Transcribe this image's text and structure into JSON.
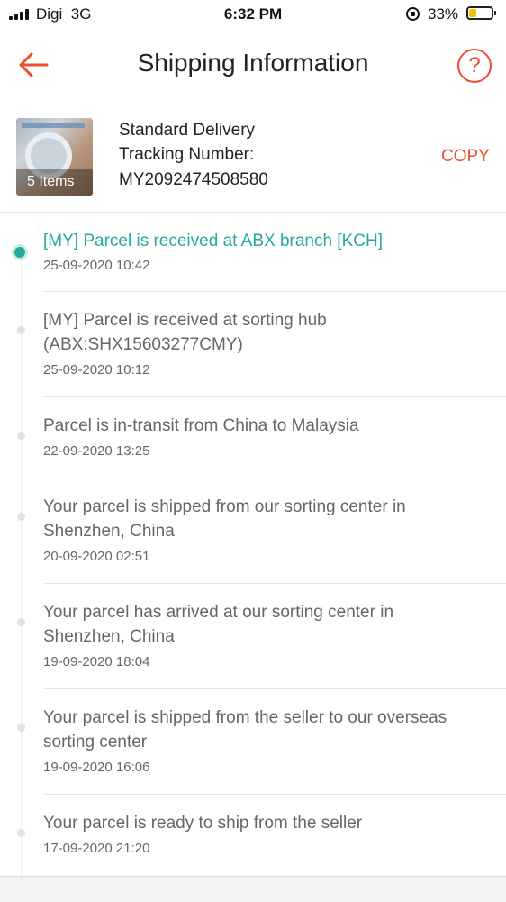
{
  "status_bar": {
    "carrier": "Digi",
    "network": "3G",
    "time": "6:32 PM",
    "battery_percent": "33%",
    "battery_level": 0.33,
    "icons": [
      "signal-icon",
      "orientation-lock-icon",
      "battery-icon"
    ]
  },
  "header": {
    "title": "Shipping Information",
    "back_icon": "back-arrow-icon",
    "help_icon": "?"
  },
  "delivery": {
    "items_label": "5 Items",
    "service": "Standard Delivery",
    "tracking_label": "Tracking Number:",
    "tracking_number": "MY2092474508580",
    "copy_label": "COPY"
  },
  "colors": {
    "accent": "#ee4d2d",
    "active_status": "#26aa99",
    "inactive_dot": "#e2e2e2"
  },
  "events": [
    {
      "text": "[MY] Parcel is received at ABX branch [KCH]",
      "time": "25-09-2020 10:42",
      "active": true
    },
    {
      "text": "[MY] Parcel is received at sorting hub (ABX:SHX15603277CMY)",
      "time": "25-09-2020 10:12",
      "active": false
    },
    {
      "text": "Parcel is in-transit from China to Malaysia",
      "time": "22-09-2020 13:25",
      "active": false
    },
    {
      "text": "Your parcel is shipped from our sorting center in Shenzhen, China",
      "time": "20-09-2020 02:51",
      "active": false
    },
    {
      "text": "Your parcel has arrived at our sorting center in Shenzhen, China",
      "time": "19-09-2020 18:04",
      "active": false
    },
    {
      "text": "Your parcel is shipped from the seller to our overseas sorting center",
      "time": "19-09-2020 16:06",
      "active": false
    },
    {
      "text": "Your parcel is ready to ship from the seller",
      "time": "17-09-2020 21:20",
      "active": false
    }
  ]
}
